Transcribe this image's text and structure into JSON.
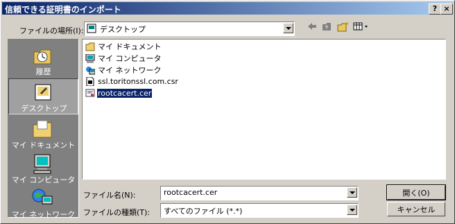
{
  "window": {
    "title": "信頼できる証明書のインポート",
    "help_label": "?",
    "close_label": "×"
  },
  "lookin": {
    "label": "ファイルの場所(I):",
    "value": "デスクトップ"
  },
  "toolbar": {
    "back_icon": "back-arrow-icon",
    "up_icon": "up-folder-icon",
    "new_folder_icon": "new-folder-icon",
    "view_icon": "view-menu-icon"
  },
  "places": [
    {
      "label": "履歴",
      "icon": "history-icon"
    },
    {
      "label": "デスクトップ",
      "icon": "desktop-icon",
      "selected": true
    },
    {
      "label": "マイ ドキュメント",
      "icon": "my-documents-icon"
    },
    {
      "label": "マイ コンピュータ",
      "icon": "my-computer-icon"
    },
    {
      "label": "マイ ネットワーク",
      "icon": "my-network-icon"
    }
  ],
  "files": [
    {
      "name": "マイ ドキュメント",
      "icon": "folder-icon"
    },
    {
      "name": "マイ コンピュータ",
      "icon": "computer-icon"
    },
    {
      "name": "マイ ネットワーク",
      "icon": "network-icon"
    },
    {
      "name": "ssl.toritonssl.com.csr",
      "icon": "file-icon"
    },
    {
      "name": "rootcacert.cer",
      "icon": "certificate-icon",
      "selected": true
    }
  ],
  "filename": {
    "label": "ファイル名(N):",
    "value": "rootcacert.cer"
  },
  "filetype": {
    "label": "ファイルの種類(T):",
    "value": "すべてのファイル (*.*)"
  },
  "buttons": {
    "open": "開く(O)",
    "cancel": "キャンセル"
  },
  "colors": {
    "titlebar": "#0a246a",
    "face": "#d4d0c8",
    "selection": "#0a246a"
  }
}
